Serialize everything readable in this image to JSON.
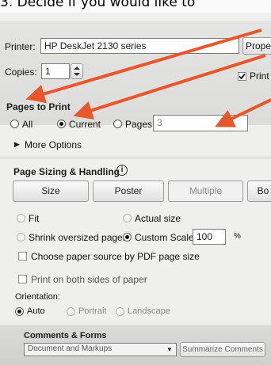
{
  "instruction": "3. Decide if you would like to",
  "printer": {
    "label": "Printer:",
    "value": "HP DeskJet 2130 series",
    "properties_button": "Prope"
  },
  "copies": {
    "label": "Copies:",
    "value": "1",
    "print_checkbox": "Print"
  },
  "pages_to_print": {
    "heading": "Pages to Print",
    "options": {
      "all": "All",
      "current": "Current",
      "pages": "Pages"
    },
    "selected": "current",
    "pages_value": "3",
    "more_options": "More Options"
  },
  "sizing": {
    "heading": "Page Sizing & Handling",
    "info_icon": "i",
    "buttons": {
      "size": "Size",
      "poster": "Poster",
      "multiple": "Multiple",
      "booklet": "Bo"
    },
    "options": {
      "fit": "Fit",
      "actual_size": "Actual size",
      "shrink": "Shrink oversized pages",
      "custom_scale": "Custom Scale:"
    },
    "scale_value": "100",
    "scale_unit": "%",
    "choose_source": "Choose paper source by PDF page size",
    "both_sides": "Print on both sides of paper",
    "orientation_label": "Orientation:",
    "orientation": {
      "auto": "Auto",
      "portrait": "Portrait",
      "landscape": "Landscape"
    }
  },
  "comments": {
    "heading": "Comments & Forms",
    "select_value": "Document and Markups",
    "summarize_button": "Summarize Comments"
  },
  "colors": {
    "arrow": "#e8562a",
    "accent_dark": "#1c1c1c"
  }
}
